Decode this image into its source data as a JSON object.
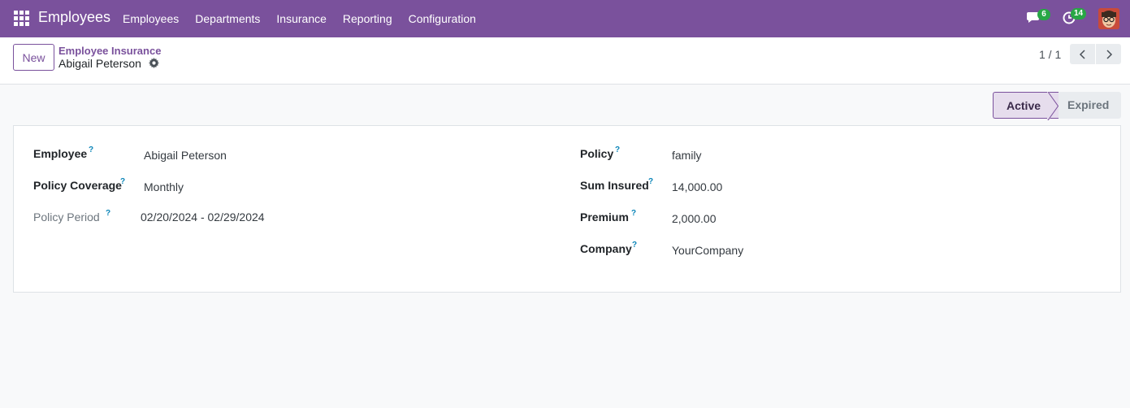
{
  "navbar": {
    "app_title": "Employees",
    "menu": [
      "Employees",
      "Departments",
      "Insurance",
      "Reporting",
      "Configuration"
    ],
    "messages_badge": "6",
    "activities_badge": "14",
    "bg_color": "#7a519c",
    "badge_color": "#28a745"
  },
  "control_panel": {
    "new_label": "New",
    "breadcrumb_parent": "Employee Insurance",
    "record_name": "Abigail Peterson",
    "pager": "1 / 1"
  },
  "statusbar": {
    "active": "Active",
    "expired": "Expired"
  },
  "form": {
    "employee": {
      "label": "Employee",
      "help": "?",
      "value": "Abigail Peterson"
    },
    "policy_coverage": {
      "label": "Policy Coverage",
      "help": "?",
      "value": "Monthly"
    },
    "policy_period": {
      "label": "Policy Period",
      "help": "?",
      "value": "02/20/2024 - 02/29/2024"
    },
    "policy": {
      "label": "Policy",
      "help": "?",
      "value": "family"
    },
    "sum_insured": {
      "label": "Sum Insured",
      "help": "?",
      "value": "14,000.00"
    },
    "premium": {
      "label": "Premium",
      "help": "?",
      "value": "2,000.00"
    },
    "company": {
      "label": "Company",
      "help": "?",
      "value": "YourCompany"
    }
  },
  "icons": [
    "apps-grid-icon",
    "chat-icon",
    "clock-icon",
    "avatar",
    "gear-icon",
    "chevron-left-icon",
    "chevron-right-icon"
  ]
}
